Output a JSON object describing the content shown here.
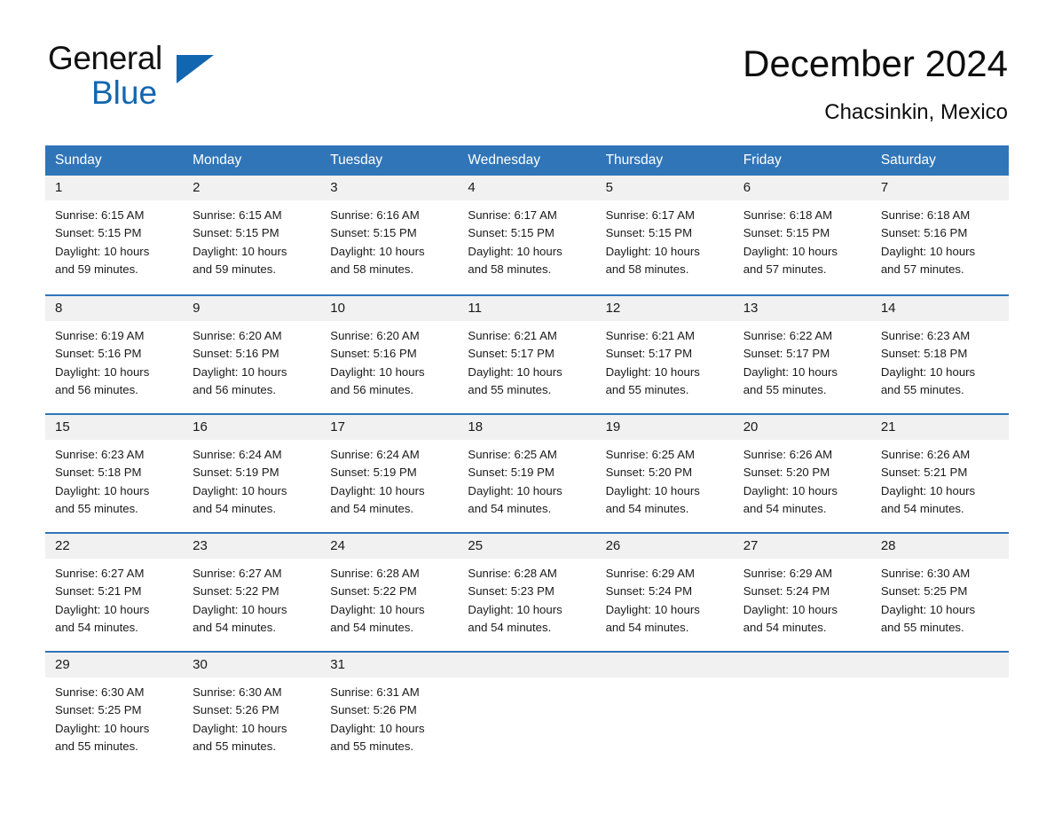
{
  "brand": {
    "name_part1": "General",
    "name_part2": "Blue",
    "triangle_icon": "triangle-icon",
    "accent_color": "#1266B0"
  },
  "header": {
    "title": "December 2024",
    "subtitle": "Chacsinkin, Mexico"
  },
  "theme": {
    "header_blue": "#3075B8",
    "daynum_bg": "#F1F1F1",
    "text": "#1a1a1a"
  },
  "weekday_headers": [
    "Sunday",
    "Monday",
    "Tuesday",
    "Wednesday",
    "Thursday",
    "Friday",
    "Saturday"
  ],
  "weeks": [
    [
      {
        "day": "1",
        "sunrise": "Sunrise: 6:15 AM",
        "sunset": "Sunset: 5:15 PM",
        "daylight1": "Daylight: 10 hours",
        "daylight2": "and 59 minutes."
      },
      {
        "day": "2",
        "sunrise": "Sunrise: 6:15 AM",
        "sunset": "Sunset: 5:15 PM",
        "daylight1": "Daylight: 10 hours",
        "daylight2": "and 59 minutes."
      },
      {
        "day": "3",
        "sunrise": "Sunrise: 6:16 AM",
        "sunset": "Sunset: 5:15 PM",
        "daylight1": "Daylight: 10 hours",
        "daylight2": "and 58 minutes."
      },
      {
        "day": "4",
        "sunrise": "Sunrise: 6:17 AM",
        "sunset": "Sunset: 5:15 PM",
        "daylight1": "Daylight: 10 hours",
        "daylight2": "and 58 minutes."
      },
      {
        "day": "5",
        "sunrise": "Sunrise: 6:17 AM",
        "sunset": "Sunset: 5:15 PM",
        "daylight1": "Daylight: 10 hours",
        "daylight2": "and 58 minutes."
      },
      {
        "day": "6",
        "sunrise": "Sunrise: 6:18 AM",
        "sunset": "Sunset: 5:15 PM",
        "daylight1": "Daylight: 10 hours",
        "daylight2": "and 57 minutes."
      },
      {
        "day": "7",
        "sunrise": "Sunrise: 6:18 AM",
        "sunset": "Sunset: 5:16 PM",
        "daylight1": "Daylight: 10 hours",
        "daylight2": "and 57 minutes."
      }
    ],
    [
      {
        "day": "8",
        "sunrise": "Sunrise: 6:19 AM",
        "sunset": "Sunset: 5:16 PM",
        "daylight1": "Daylight: 10 hours",
        "daylight2": "and 56 minutes."
      },
      {
        "day": "9",
        "sunrise": "Sunrise: 6:20 AM",
        "sunset": "Sunset: 5:16 PM",
        "daylight1": "Daylight: 10 hours",
        "daylight2": "and 56 minutes."
      },
      {
        "day": "10",
        "sunrise": "Sunrise: 6:20 AM",
        "sunset": "Sunset: 5:16 PM",
        "daylight1": "Daylight: 10 hours",
        "daylight2": "and 56 minutes."
      },
      {
        "day": "11",
        "sunrise": "Sunrise: 6:21 AM",
        "sunset": "Sunset: 5:17 PM",
        "daylight1": "Daylight: 10 hours",
        "daylight2": "and 55 minutes."
      },
      {
        "day": "12",
        "sunrise": "Sunrise: 6:21 AM",
        "sunset": "Sunset: 5:17 PM",
        "daylight1": "Daylight: 10 hours",
        "daylight2": "and 55 minutes."
      },
      {
        "day": "13",
        "sunrise": "Sunrise: 6:22 AM",
        "sunset": "Sunset: 5:17 PM",
        "daylight1": "Daylight: 10 hours",
        "daylight2": "and 55 minutes."
      },
      {
        "day": "14",
        "sunrise": "Sunrise: 6:23 AM",
        "sunset": "Sunset: 5:18 PM",
        "daylight1": "Daylight: 10 hours",
        "daylight2": "and 55 minutes."
      }
    ],
    [
      {
        "day": "15",
        "sunrise": "Sunrise: 6:23 AM",
        "sunset": "Sunset: 5:18 PM",
        "daylight1": "Daylight: 10 hours",
        "daylight2": "and 55 minutes."
      },
      {
        "day": "16",
        "sunrise": "Sunrise: 6:24 AM",
        "sunset": "Sunset: 5:19 PM",
        "daylight1": "Daylight: 10 hours",
        "daylight2": "and 54 minutes."
      },
      {
        "day": "17",
        "sunrise": "Sunrise: 6:24 AM",
        "sunset": "Sunset: 5:19 PM",
        "daylight1": "Daylight: 10 hours",
        "daylight2": "and 54 minutes."
      },
      {
        "day": "18",
        "sunrise": "Sunrise: 6:25 AM",
        "sunset": "Sunset: 5:19 PM",
        "daylight1": "Daylight: 10 hours",
        "daylight2": "and 54 minutes."
      },
      {
        "day": "19",
        "sunrise": "Sunrise: 6:25 AM",
        "sunset": "Sunset: 5:20 PM",
        "daylight1": "Daylight: 10 hours",
        "daylight2": "and 54 minutes."
      },
      {
        "day": "20",
        "sunrise": "Sunrise: 6:26 AM",
        "sunset": "Sunset: 5:20 PM",
        "daylight1": "Daylight: 10 hours",
        "daylight2": "and 54 minutes."
      },
      {
        "day": "21",
        "sunrise": "Sunrise: 6:26 AM",
        "sunset": "Sunset: 5:21 PM",
        "daylight1": "Daylight: 10 hours",
        "daylight2": "and 54 minutes."
      }
    ],
    [
      {
        "day": "22",
        "sunrise": "Sunrise: 6:27 AM",
        "sunset": "Sunset: 5:21 PM",
        "daylight1": "Daylight: 10 hours",
        "daylight2": "and 54 minutes."
      },
      {
        "day": "23",
        "sunrise": "Sunrise: 6:27 AM",
        "sunset": "Sunset: 5:22 PM",
        "daylight1": "Daylight: 10 hours",
        "daylight2": "and 54 minutes."
      },
      {
        "day": "24",
        "sunrise": "Sunrise: 6:28 AM",
        "sunset": "Sunset: 5:22 PM",
        "daylight1": "Daylight: 10 hours",
        "daylight2": "and 54 minutes."
      },
      {
        "day": "25",
        "sunrise": "Sunrise: 6:28 AM",
        "sunset": "Sunset: 5:23 PM",
        "daylight1": "Daylight: 10 hours",
        "daylight2": "and 54 minutes."
      },
      {
        "day": "26",
        "sunrise": "Sunrise: 6:29 AM",
        "sunset": "Sunset: 5:24 PM",
        "daylight1": "Daylight: 10 hours",
        "daylight2": "and 54 minutes."
      },
      {
        "day": "27",
        "sunrise": "Sunrise: 6:29 AM",
        "sunset": "Sunset: 5:24 PM",
        "daylight1": "Daylight: 10 hours",
        "daylight2": "and 54 minutes."
      },
      {
        "day": "28",
        "sunrise": "Sunrise: 6:30 AM",
        "sunset": "Sunset: 5:25 PM",
        "daylight1": "Daylight: 10 hours",
        "daylight2": "and 55 minutes."
      }
    ],
    [
      {
        "day": "29",
        "sunrise": "Sunrise: 6:30 AM",
        "sunset": "Sunset: 5:25 PM",
        "daylight1": "Daylight: 10 hours",
        "daylight2": "and 55 minutes."
      },
      {
        "day": "30",
        "sunrise": "Sunrise: 6:30 AM",
        "sunset": "Sunset: 5:26 PM",
        "daylight1": "Daylight: 10 hours",
        "daylight2": "and 55 minutes."
      },
      {
        "day": "31",
        "sunrise": "Sunrise: 6:31 AM",
        "sunset": "Sunset: 5:26 PM",
        "daylight1": "Daylight: 10 hours",
        "daylight2": "and 55 minutes."
      },
      {
        "day": "",
        "sunrise": "",
        "sunset": "",
        "daylight1": "",
        "daylight2": ""
      },
      {
        "day": "",
        "sunrise": "",
        "sunset": "",
        "daylight1": "",
        "daylight2": ""
      },
      {
        "day": "",
        "sunrise": "",
        "sunset": "",
        "daylight1": "",
        "daylight2": ""
      },
      {
        "day": "",
        "sunrise": "",
        "sunset": "",
        "daylight1": "",
        "daylight2": ""
      }
    ]
  ]
}
